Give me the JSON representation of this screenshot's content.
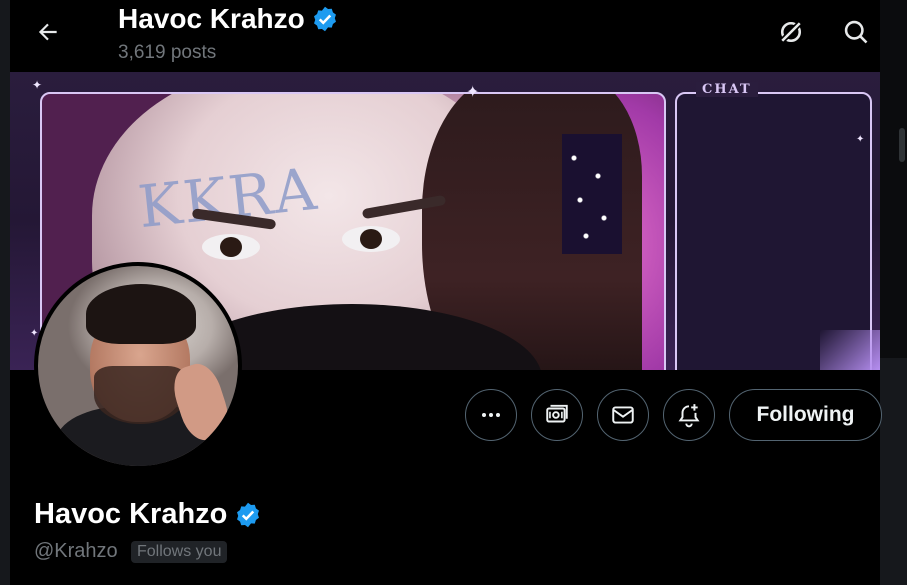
{
  "header": {
    "title": "Havoc Krahzo",
    "posts_count": "3,619 posts"
  },
  "banner": {
    "forehead_text": "KKRA",
    "chat_label": "CHAT"
  },
  "profile": {
    "display_name": "Havoc Krahzo",
    "handle": "@Krahzo",
    "follows_you_badge": "Follows you"
  },
  "actions": {
    "following_label": "Following"
  },
  "icons": {
    "back": "back-arrow-icon",
    "grok": "grok-icon",
    "search": "search-icon",
    "verified": "verified-badge-icon",
    "more": "more-icon",
    "subscribe": "subscribe-icon",
    "message": "envelope-icon",
    "notify": "bell-plus-icon"
  },
  "colors": {
    "background": "#000000",
    "verified": "#1d9bf0",
    "muted_text": "#71767b",
    "border": "#536471"
  }
}
